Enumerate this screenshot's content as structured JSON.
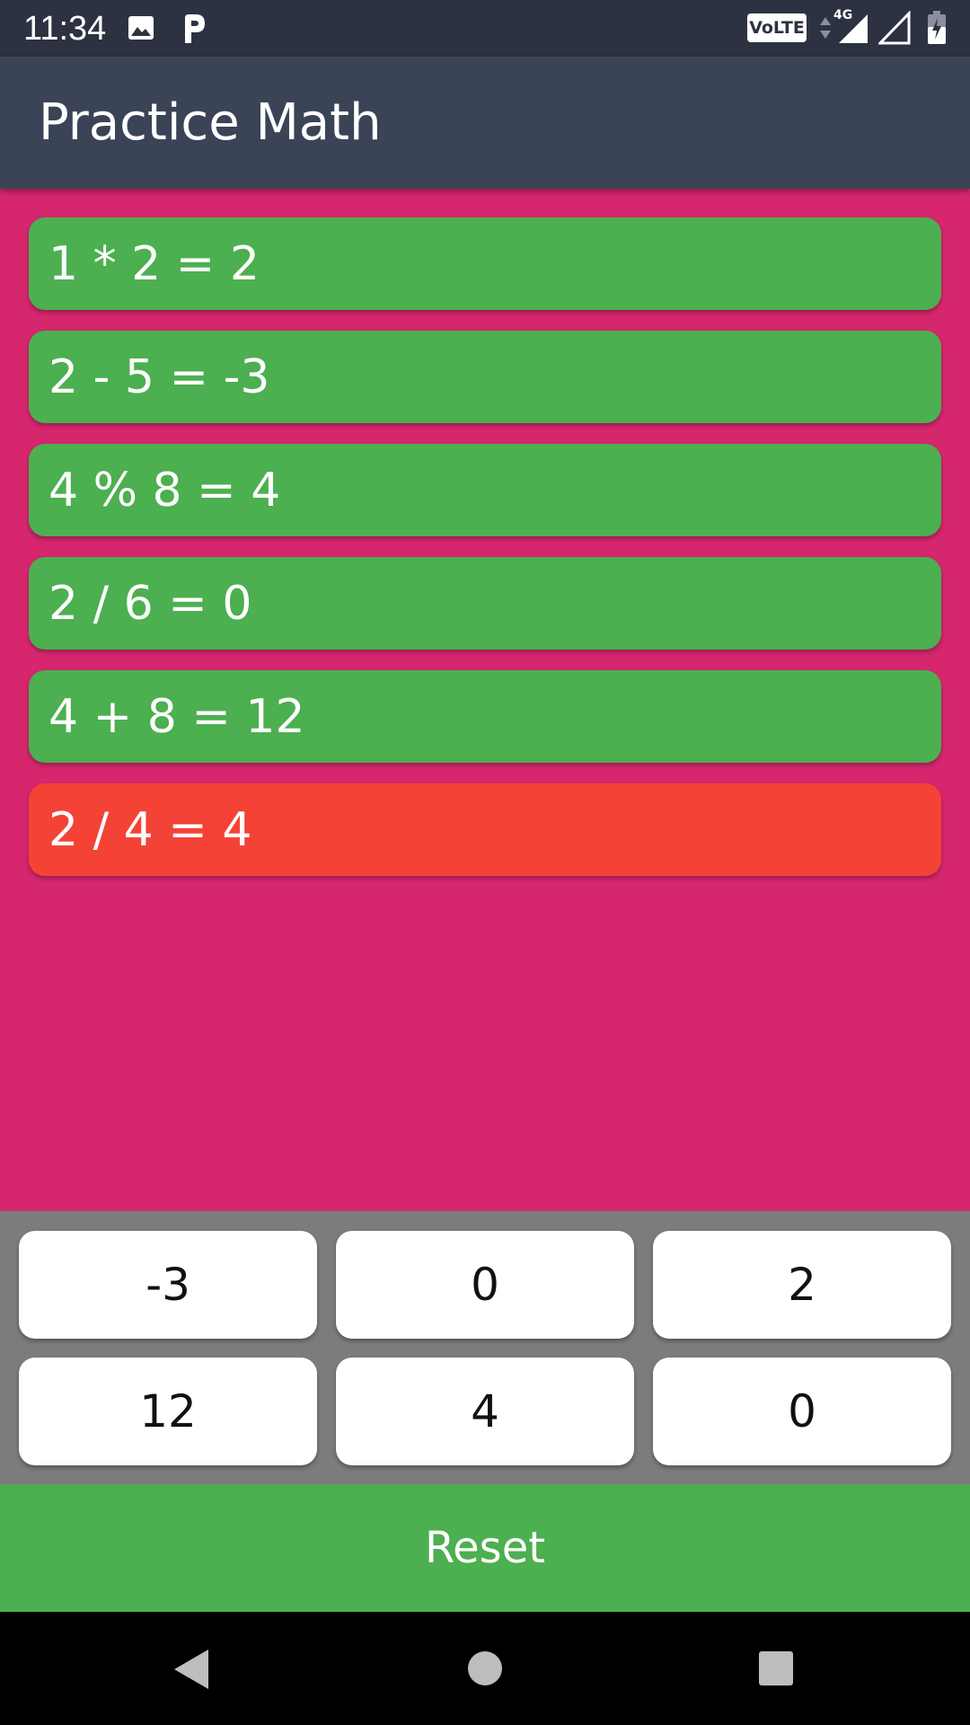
{
  "status_bar": {
    "time": "11:34",
    "volte": "VoLTE",
    "network": "4G",
    "icons": [
      "gallery-icon",
      "p-app-icon",
      "data-arrows-icon",
      "signal-4g-icon",
      "signal-empty-icon",
      "battery-charging-icon"
    ]
  },
  "app_bar": {
    "title": "Practice Math"
  },
  "questions": [
    {
      "text": "1 * 2 = 2",
      "status": "correct"
    },
    {
      "text": "2 - 5 = -3",
      "status": "correct"
    },
    {
      "text": "4 % 8 = 4",
      "status": "correct"
    },
    {
      "text": "2 / 6 = 0",
      "status": "correct"
    },
    {
      "text": "4 + 8 = 12",
      "status": "correct"
    },
    {
      "text": "2 / 4 = 4",
      "status": "wrong"
    }
  ],
  "answers": [
    "-3",
    "0",
    "2",
    "12",
    "4",
    "0"
  ],
  "reset_label": "Reset",
  "colors": {
    "background": "#d6266e",
    "app_bar": "#3b4357",
    "status_bar": "#2c3241",
    "correct": "#4caf50",
    "wrong": "#f44336",
    "answer_panel": "#7c7c7c",
    "reset": "#4caf50"
  },
  "nav_bar": {
    "icons": [
      "back-icon",
      "home-icon",
      "recents-icon"
    ]
  }
}
